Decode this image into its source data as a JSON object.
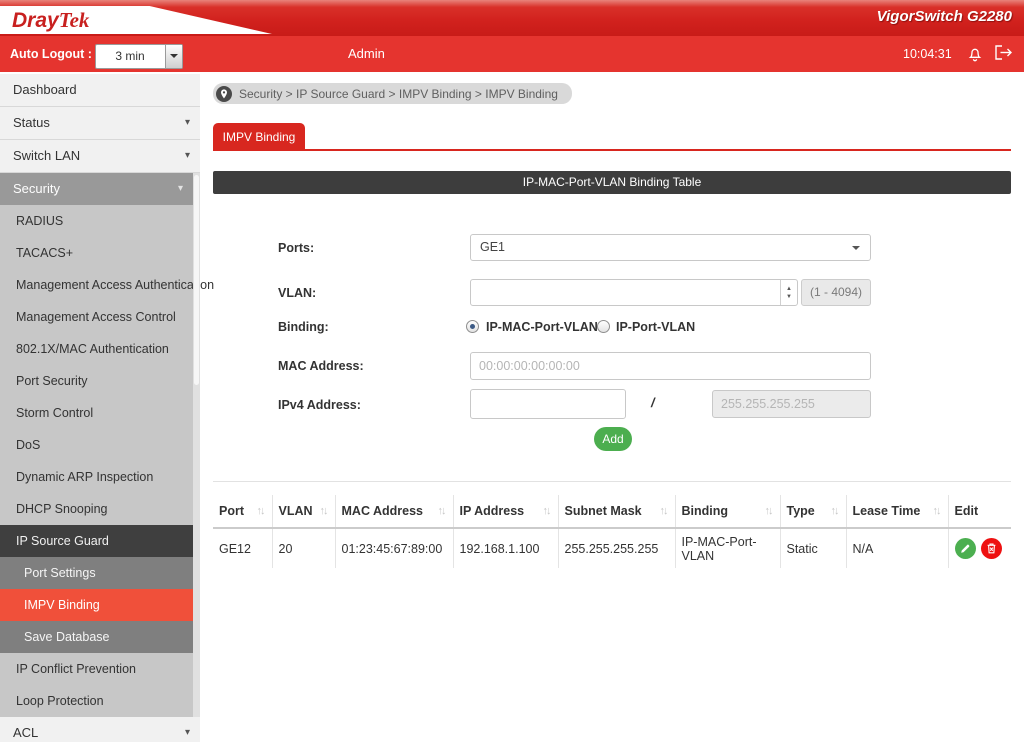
{
  "header": {
    "brand_dray": "Dray",
    "brand_tek": "Tek",
    "product": "VigorSwitch G2280",
    "auto_logout_label": "Auto Logout :",
    "auto_logout_value": "3 min",
    "user": "Admin",
    "time": "10:04:31"
  },
  "breadcrumb": {
    "text": "Security > IP Source Guard > IMPV Binding  > IMPV Binding"
  },
  "tab": {
    "label": "IMPV Binding"
  },
  "panel": {
    "title": "IP-MAC-Port-VLAN Binding Table",
    "ports_label": "Ports:",
    "ports_value": "GE1",
    "vlan_label": "VLAN:",
    "vlan_value": "",
    "vlan_hint": "(1 - 4094)",
    "binding_label": "Binding:",
    "binding_option1": "IP-MAC-Port-VLAN",
    "binding_option2": "IP-Port-VLAN",
    "mac_label": "MAC Address:",
    "mac_placeholder": "00:00:00:00:00:00",
    "ipv4_label": "IPv4 Address:",
    "ipv4_value": "",
    "separator": "/",
    "mask_placeholder": "255.255.255.255",
    "add_label": "Add"
  },
  "table": {
    "columns": [
      "Port",
      "VLAN",
      "MAC Address",
      "IP Address",
      "Subnet Mask",
      "Binding",
      "Type",
      "Lease Time",
      "Edit"
    ],
    "row": {
      "port": "GE12",
      "vlan": "20",
      "mac": "01:23:45:67:89:00",
      "ip": "192.168.1.100",
      "mask": "255.255.255.255",
      "binding": "IP-MAC-Port-VLAN",
      "type": "Static",
      "lease": "N/A"
    }
  },
  "sidebar": {
    "items": [
      {
        "label": "Dashboard"
      },
      {
        "label": "Status"
      },
      {
        "label": "Switch LAN"
      },
      {
        "label": "Security"
      },
      {
        "label": "RADIUS"
      },
      {
        "label": "TACACS+"
      },
      {
        "label": "Management Access Authentication"
      },
      {
        "label": "Management Access Control"
      },
      {
        "label": "802.1X/MAC Authentication"
      },
      {
        "label": "Port Security"
      },
      {
        "label": "Storm Control"
      },
      {
        "label": "DoS"
      },
      {
        "label": "Dynamic ARP Inspection"
      },
      {
        "label": "DHCP Snooping"
      },
      {
        "label": "IP Source Guard"
      },
      {
        "label": "Port Settings"
      },
      {
        "label": "IMPV Binding"
      },
      {
        "label": "Save Database"
      },
      {
        "label": "IP Conflict Prevention"
      },
      {
        "label": "Loop Protection"
      },
      {
        "label": "ACL"
      }
    ]
  },
  "colors": {
    "brand_red": "#c8201f",
    "banner_red": "#d2221e",
    "adminbar_red": "#e5342f",
    "tab_red": "#d8271f",
    "active_item_red": "#f0503a",
    "panel_header_gray": "#3d3d3d",
    "add_green": "#4cae4f",
    "edit_green": "#4caf50",
    "delete_red": "#ee1111"
  }
}
